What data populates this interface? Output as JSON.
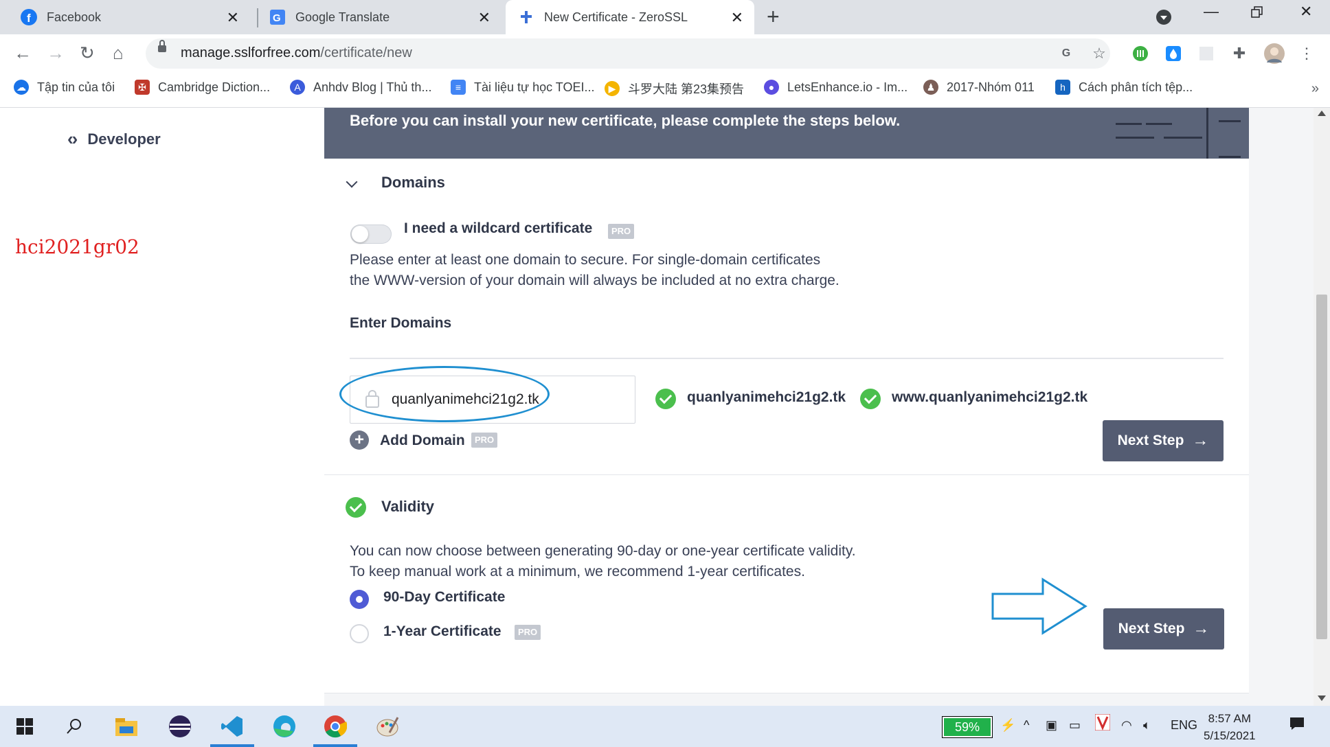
{
  "browser": {
    "tabs": [
      {
        "title": "Facebook",
        "icon": "facebook-icon"
      },
      {
        "title": "Google Translate",
        "icon": "google-translate-icon"
      },
      {
        "title": "New Certificate - ZeroSSL",
        "icon": "zerossl-icon",
        "active": true
      }
    ],
    "url": {
      "host": "manage.sslforfree.com",
      "path": "/certificate/new"
    },
    "bookmarks": [
      {
        "label": "Tập tin của tôi",
        "icon": "cloud-icon",
        "color": "#1a73e8"
      },
      {
        "label": "Cambridge Diction...",
        "icon": "cambridge-icon",
        "color": "#c0392b"
      },
      {
        "label": "Anhdv Blog | Thủ th...",
        "icon": "blog-icon",
        "color": "#3b5bdb"
      },
      {
        "label": "Tài liệu tự học TOEI...",
        "icon": "docs-icon",
        "color": "#4285f4"
      },
      {
        "label": "斗罗大陆 第23集预告",
        "icon": "play-icon",
        "color": "#f4b400"
      },
      {
        "label": "LetsEnhance.io - Im...",
        "icon": "letsenhance-icon",
        "color": "#5b4de0"
      },
      {
        "label": "2017-Nhóm 011",
        "icon": "group-icon",
        "color": "#7b5e57"
      },
      {
        "label": "Cách phân tích tệp...",
        "icon": "h-icon",
        "color": "#1565c0"
      }
    ]
  },
  "sidebar": {
    "developer_label": "Developer"
  },
  "watermark": "hci2021gr02",
  "banner": {
    "text": "Before you can install your new certificate, please complete the steps below."
  },
  "domains": {
    "title": "Domains",
    "wildcard_label": "I need a wildcard certificate",
    "pro": "PRO",
    "description_line1": "Please enter at least one domain to secure. For single-domain certificates",
    "description_line2": "the WWW-version of your domain will always be included at no extra charge.",
    "enter_label": "Enter Domains",
    "input_value": "quanlyanimehci21g2.tk",
    "verified": [
      "quanlyanimehci21g2.tk",
      "www.quanlyanimehci21g2.tk"
    ],
    "add_domain_label": "Add Domain",
    "next_label": "Next Step"
  },
  "validity": {
    "title": "Validity",
    "description_line1": "You can now choose between generating 90-day or one-year certificate validity.",
    "description_line2": "To keep manual work at a minimum, we recommend 1-year certificates.",
    "options": [
      {
        "label": "90-Day Certificate",
        "selected": true
      },
      {
        "label": "1-Year Certificate",
        "selected": false,
        "pro": "PRO"
      }
    ],
    "next_label": "Next Step"
  },
  "taskbar": {
    "battery": "59%",
    "language": "ENG",
    "time": "8:57 AM",
    "date": "5/15/2021"
  },
  "colors": {
    "accent": "#545c72",
    "banner": "#5b6479",
    "success": "#4bbf4d",
    "radio": "#4f5bd5",
    "annotation": "#1f8fd0",
    "watermark": "#e02020"
  }
}
